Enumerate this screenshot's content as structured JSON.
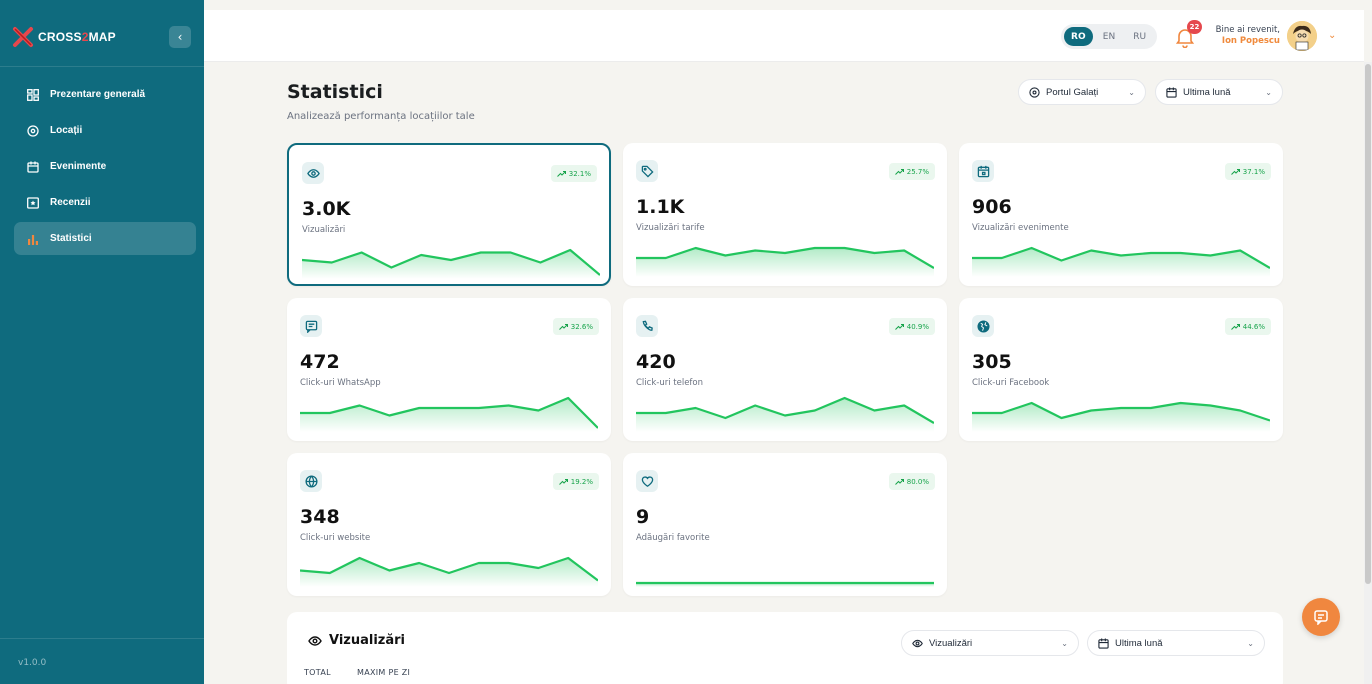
{
  "brand": {
    "name_part1": "CROSS",
    "name_part2": "2",
    "name_part3": "MAP"
  },
  "sidebar": {
    "items": [
      {
        "label": "Prezentare generală",
        "icon": "dashboard-icon"
      },
      {
        "label": "Locații",
        "icon": "location-pin-icon"
      },
      {
        "label": "Evenimente",
        "icon": "calendar-icon"
      },
      {
        "label": "Recenzii",
        "icon": "review-star-icon"
      },
      {
        "label": "Statistici",
        "icon": "bar-chart-icon",
        "active": true
      }
    ],
    "version": "v1.0.0"
  },
  "header": {
    "languages": [
      "RO",
      "EN",
      "RU"
    ],
    "active_language": "RO",
    "notifications_count": "22",
    "welcome": "Bine ai revenit,",
    "user_name": "Ion Popescu"
  },
  "page": {
    "title": "Statistici",
    "subtitle": "Analizează performanța locațiilor tale",
    "location_filter": "Portul Galați",
    "period_filter": "Ultima lună"
  },
  "cards": [
    {
      "value": "3.0K",
      "label": "Vizualizări",
      "trend": "32.1%",
      "icon": "eye-icon",
      "spark": [
        6,
        5,
        9,
        3,
        8,
        6,
        9,
        9,
        5,
        10,
        0
      ]
    },
    {
      "value": "1.1K",
      "label": "Vizualizări tarife",
      "trend": "25.7%",
      "icon": "tag-icon",
      "spark": [
        6,
        6,
        10,
        7,
        9,
        8,
        10,
        10,
        8,
        9,
        2
      ]
    },
    {
      "value": "906",
      "label": "Vizualizări evenimente",
      "trend": "37.1%",
      "icon": "calendar-icon",
      "spark": [
        6,
        6,
        10,
        5,
        9,
        7,
        8,
        8,
        7,
        9,
        2
      ]
    },
    {
      "value": "472",
      "label": "Click-uri WhatsApp",
      "trend": "32.6%",
      "icon": "message-icon",
      "spark": [
        6,
        6,
        9,
        5,
        8,
        8,
        8,
        9,
        7,
        12,
        0
      ]
    },
    {
      "value": "420",
      "label": "Click-uri telefon",
      "trend": "40.9%",
      "icon": "phone-icon",
      "spark": [
        6,
        6,
        8,
        4,
        9,
        5,
        7,
        12,
        7,
        9,
        2
      ]
    },
    {
      "value": "305",
      "label": "Click-uri Facebook",
      "trend": "44.6%",
      "icon": "globe-solid-icon",
      "spark": [
        6,
        6,
        10,
        4,
        7,
        8,
        8,
        10,
        9,
        7,
        3
      ]
    },
    {
      "value": "348",
      "label": "Click-uri website",
      "trend": "19.2%",
      "icon": "globe-icon",
      "spark": [
        5,
        4,
        10,
        5,
        8,
        4,
        8,
        8,
        6,
        10,
        1
      ]
    },
    {
      "value": "9",
      "label": "Adăugări favorite",
      "trend": "80.0%",
      "icon": "heart-icon",
      "spark": [
        0,
        0,
        0,
        0,
        0,
        0,
        0,
        0,
        0,
        0,
        0
      ]
    }
  ],
  "chart_panel": {
    "title": "Vizualizări",
    "metric_select": "Vizualizări",
    "period_select": "Ultima lună",
    "tabs": [
      "TOTAL",
      "MAXIM PE ZI"
    ]
  },
  "colors": {
    "sidebar": "#0f6b7e",
    "accent_orange": "#f0873f",
    "trend_green": "#16a34a",
    "line_green": "#22c55e"
  }
}
